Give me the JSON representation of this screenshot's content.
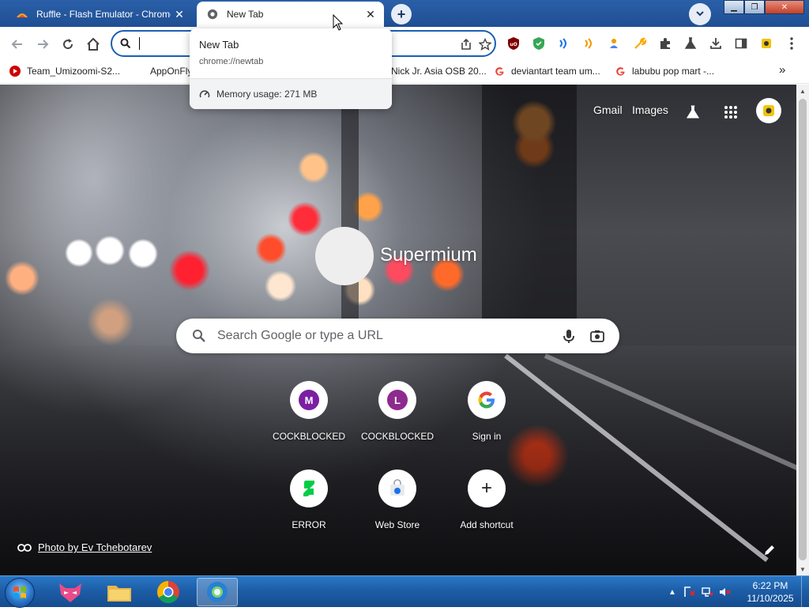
{
  "tabs": [
    {
      "title": "Ruffle - Flash Emulator - Chrome",
      "close": "✕"
    },
    {
      "title": "New Tab",
      "close": "✕"
    }
  ],
  "new_tab_button": "+",
  "omnibox": {
    "value": "",
    "placeholder": ""
  },
  "bookmarks": [
    {
      "label": "Team_Umizoomi-S2...",
      "icon": "youtube-icon"
    },
    {
      "label": "AppOnFly",
      "icon": ""
    },
    {
      "label": "Nick Jr. Asia OSB 20...",
      "icon": ""
    },
    {
      "label": "deviantart team um...",
      "icon": "google-icon"
    },
    {
      "label": "labubu pop mart -...",
      "icon": "google-icon"
    }
  ],
  "bookmarks_overflow": "»",
  "hover_card": {
    "title": "New Tab",
    "url": "chrome://newtab",
    "memory": "Memory usage: 271 MB"
  },
  "ntp": {
    "gmail": "Gmail",
    "images": "Images",
    "logo_text": "Supermium",
    "search_placeholder": "Search Google or type a URL",
    "shortcuts": [
      {
        "label": "COCKBLOCKED",
        "letter": "M",
        "color": "#7b1fa2"
      },
      {
        "label": "COCKBLOCKED",
        "letter": "L",
        "color": "#8e2a8e"
      },
      {
        "label": "Sign in",
        "letter": "G",
        "color": "#4285f4"
      },
      {
        "label": "ERROR",
        "letter": "",
        "color": "#1db954"
      },
      {
        "label": "Web Store",
        "letter": "",
        "color": "#1a73e8"
      },
      {
        "label": "Add shortcut",
        "letter": "+",
        "color": "#202124"
      }
    ],
    "photo_credit": "Photo by Ev Tchebotarev"
  },
  "taskbar": {
    "time": "6:22 PM",
    "date": "11/10/2025"
  },
  "colors": {
    "tabstrip": "#1f4f93",
    "omnibox_border": "#1a5fb4",
    "taskbar": "#1d5ea8"
  }
}
